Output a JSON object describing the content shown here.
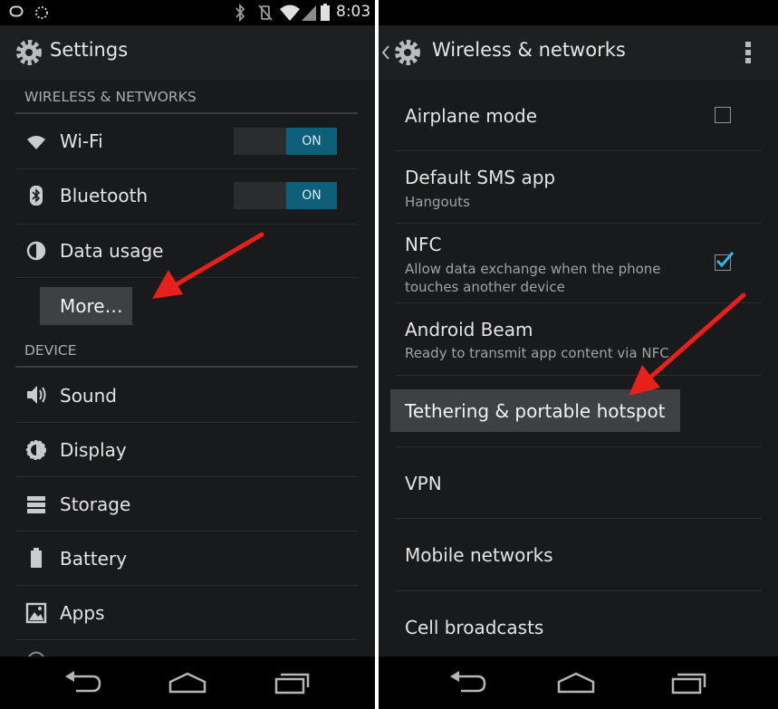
{
  "left": {
    "status": {
      "time": "8:03"
    },
    "title": "Settings",
    "sections": {
      "wireless": "WIRELESS & NETWORKS",
      "device": "DEVICE"
    },
    "items": {
      "wifi": "Wi-Fi",
      "bluetooth": "Bluetooth",
      "data_usage": "Data usage",
      "more": "More…",
      "sound": "Sound",
      "display": "Display",
      "storage": "Storage",
      "battery": "Battery",
      "apps": "Apps"
    },
    "toggles": {
      "wifi": "ON",
      "bluetooth": "ON"
    }
  },
  "right": {
    "title": "Wireless & networks",
    "items": {
      "airplane": {
        "title": "Airplane mode",
        "checked": false
      },
      "sms": {
        "title": "Default SMS app",
        "summary": "Hangouts"
      },
      "nfc": {
        "title": "NFC",
        "summary_1": "Allow data exchange when the phone",
        "summary_2": "touches another device",
        "checked": true
      },
      "beam": {
        "title": "Android Beam",
        "summary": "Ready to transmit app content via NFC"
      },
      "tethering": "Tethering & portable hotspot",
      "vpn": "VPN",
      "mobile": "Mobile networks",
      "cell": "Cell broadcasts"
    }
  },
  "colors": {
    "accent": "#0e5f7a",
    "checkmark": "#33b5e5",
    "arrow": "#e8201c"
  }
}
